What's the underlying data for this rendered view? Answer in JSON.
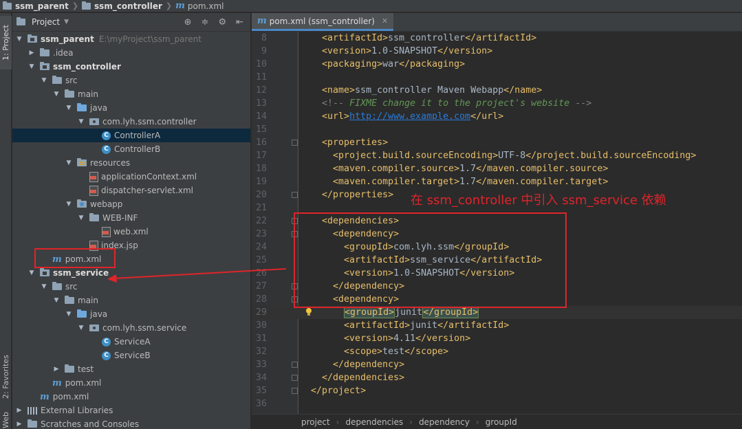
{
  "breadcrumb": [
    {
      "label": "ssm_parent",
      "icon": "folder-icon"
    },
    {
      "label": "ssm_controller",
      "icon": "folder-icon"
    },
    {
      "label": "pom.xml",
      "icon": "maven-icon"
    }
  ],
  "tool_strip": {
    "project_tab": "1: Project",
    "favorites_tab": "2: Favorites",
    "web_tab": "Web"
  },
  "project_panel": {
    "title": "Project",
    "tools": [
      "locate-icon",
      "collapse-icon",
      "gear-icon",
      "hide-icon"
    ],
    "tree": [
      {
        "label": "ssm_parent",
        "suffix": "E:\\myProject\\ssm_parent",
        "depth": 0,
        "arrow": "open",
        "icon": "module-folder",
        "bold": true
      },
      {
        "label": ".idea",
        "depth": 1,
        "arrow": "closed",
        "icon": "folder"
      },
      {
        "label": "ssm_controller",
        "depth": 1,
        "arrow": "open",
        "icon": "module-folder",
        "bold": true
      },
      {
        "label": "src",
        "depth": 2,
        "arrow": "open",
        "icon": "folder"
      },
      {
        "label": "main",
        "depth": 3,
        "arrow": "open",
        "icon": "folder"
      },
      {
        "label": "java",
        "depth": 4,
        "arrow": "open",
        "icon": "blue-folder"
      },
      {
        "label": "com.lyh.ssm.controller",
        "depth": 5,
        "arrow": "open",
        "icon": "package"
      },
      {
        "label": "ControllerA",
        "depth": 6,
        "arrow": "none",
        "icon": "class",
        "selected": true
      },
      {
        "label": "ControllerB",
        "depth": 6,
        "arrow": "none",
        "icon": "class"
      },
      {
        "label": "resources",
        "depth": 4,
        "arrow": "open",
        "icon": "resources-folder"
      },
      {
        "label": "applicationContext.xml",
        "depth": 5,
        "arrow": "none",
        "icon": "xml"
      },
      {
        "label": "dispatcher-servlet.xml",
        "depth": 5,
        "arrow": "none",
        "icon": "xml"
      },
      {
        "label": "webapp",
        "depth": 4,
        "arrow": "open",
        "icon": "web-folder"
      },
      {
        "label": "WEB-INF",
        "depth": 5,
        "arrow": "open",
        "icon": "folder"
      },
      {
        "label": "web.xml",
        "depth": 6,
        "arrow": "none",
        "icon": "xml"
      },
      {
        "label": "index.jsp",
        "depth": 5,
        "arrow": "none",
        "icon": "xml"
      },
      {
        "label": "pom.xml",
        "depth": 2,
        "arrow": "none",
        "icon": "maven"
      },
      {
        "label": "ssm_service",
        "depth": 1,
        "arrow": "open",
        "icon": "module-folder",
        "bold": true
      },
      {
        "label": "src",
        "depth": 2,
        "arrow": "open",
        "icon": "folder"
      },
      {
        "label": "main",
        "depth": 3,
        "arrow": "open",
        "icon": "folder"
      },
      {
        "label": "java",
        "depth": 4,
        "arrow": "open",
        "icon": "blue-folder"
      },
      {
        "label": "com.lyh.ssm.service",
        "depth": 5,
        "arrow": "open",
        "icon": "package"
      },
      {
        "label": "ServiceA",
        "depth": 6,
        "arrow": "none",
        "icon": "class"
      },
      {
        "label": "ServiceB",
        "depth": 6,
        "arrow": "none",
        "icon": "class"
      },
      {
        "label": "test",
        "depth": 3,
        "arrow": "closed",
        "icon": "folder"
      },
      {
        "label": "pom.xml",
        "depth": 2,
        "arrow": "none",
        "icon": "maven"
      },
      {
        "label": "pom.xml",
        "depth": 1,
        "arrow": "none",
        "icon": "maven"
      },
      {
        "label": "External Libraries",
        "depth": 0,
        "arrow": "closed",
        "icon": "library"
      },
      {
        "label": "Scratches and Consoles",
        "depth": 0,
        "arrow": "closed",
        "icon": "folder"
      }
    ]
  },
  "editor": {
    "tab_label": "pom.xml (ssm_controller)",
    "current_line": 29,
    "lines": [
      {
        "n": 8,
        "segs": [
          [
            "i",
            "    "
          ],
          [
            "t",
            "<artifactId>"
          ],
          [
            "x",
            "ssm_controller"
          ],
          [
            "t",
            "</artifactId>"
          ]
        ]
      },
      {
        "n": 9,
        "segs": [
          [
            "i",
            "    "
          ],
          [
            "t",
            "<version>"
          ],
          [
            "x",
            "1.0-SNAPSHOT"
          ],
          [
            "t",
            "</version>"
          ]
        ]
      },
      {
        "n": 10,
        "segs": [
          [
            "i",
            "    "
          ],
          [
            "t",
            "<packaging>"
          ],
          [
            "x",
            "war"
          ],
          [
            "t",
            "</packaging>"
          ]
        ]
      },
      {
        "n": 11,
        "segs": []
      },
      {
        "n": 12,
        "segs": [
          [
            "i",
            "    "
          ],
          [
            "t",
            "<name>"
          ],
          [
            "x",
            "ssm_controller Maven Webapp"
          ],
          [
            "t",
            "</name>"
          ]
        ]
      },
      {
        "n": 13,
        "segs": [
          [
            "i",
            "    "
          ],
          [
            "cmd",
            "<!-- "
          ],
          [
            "cm",
            "FIXME change it to the project's website"
          ],
          [
            "cmd",
            " -->"
          ]
        ]
      },
      {
        "n": 14,
        "segs": [
          [
            "i",
            "    "
          ],
          [
            "t",
            "<url>"
          ],
          [
            "lnk",
            "http://www.example.com"
          ],
          [
            "t",
            "</url>"
          ]
        ]
      },
      {
        "n": 15,
        "segs": []
      },
      {
        "n": 16,
        "segs": [
          [
            "i",
            "    "
          ],
          [
            "t",
            "<properties>"
          ]
        ],
        "fold": true
      },
      {
        "n": 17,
        "segs": [
          [
            "i",
            "      "
          ],
          [
            "t",
            "<project.build.sourceEncoding>"
          ],
          [
            "x",
            "UTF-8"
          ],
          [
            "t",
            "</project.build.sourceEncoding>"
          ]
        ]
      },
      {
        "n": 18,
        "segs": [
          [
            "i",
            "      "
          ],
          [
            "t",
            "<maven.compiler.source>"
          ],
          [
            "x",
            "1.7"
          ],
          [
            "t",
            "</maven.compiler.source>"
          ]
        ]
      },
      {
        "n": 19,
        "segs": [
          [
            "i",
            "      "
          ],
          [
            "t",
            "<maven.compiler.target>"
          ],
          [
            "x",
            "1.7"
          ],
          [
            "t",
            "</maven.compiler.target>"
          ]
        ]
      },
      {
        "n": 20,
        "segs": [
          [
            "i",
            "    "
          ],
          [
            "t",
            "</properties>"
          ]
        ],
        "fold": true
      },
      {
        "n": 21,
        "segs": []
      },
      {
        "n": 22,
        "segs": [
          [
            "i",
            "    "
          ],
          [
            "t",
            "<dependencies>"
          ]
        ],
        "fold": true
      },
      {
        "n": 23,
        "segs": [
          [
            "i",
            "      "
          ],
          [
            "t",
            "<dependency>"
          ]
        ],
        "fold": true
      },
      {
        "n": 24,
        "segs": [
          [
            "i",
            "        "
          ],
          [
            "t",
            "<groupId>"
          ],
          [
            "x",
            "com.lyh.ssm"
          ],
          [
            "t",
            "</groupId>"
          ]
        ]
      },
      {
        "n": 25,
        "segs": [
          [
            "i",
            "        "
          ],
          [
            "t",
            "<artifactId>"
          ],
          [
            "x",
            "ssm_service"
          ],
          [
            "t",
            "</artifactId>"
          ]
        ]
      },
      {
        "n": 26,
        "segs": [
          [
            "i",
            "        "
          ],
          [
            "t",
            "<version>"
          ],
          [
            "x",
            "1.0-SNAPSHOT"
          ],
          [
            "t",
            "</version>"
          ]
        ]
      },
      {
        "n": 27,
        "segs": [
          [
            "i",
            "      "
          ],
          [
            "t",
            "</dependency>"
          ]
        ],
        "fold": true
      },
      {
        "n": 28,
        "segs": [
          [
            "i",
            "      "
          ],
          [
            "t",
            "<dependency>"
          ]
        ],
        "fold": true
      },
      {
        "n": 29,
        "segs": [
          [
            "i",
            "        "
          ],
          [
            "th",
            "<groupId>"
          ],
          [
            "x",
            "junit"
          ],
          [
            "th",
            "</groupId>"
          ]
        ],
        "bulb": true
      },
      {
        "n": 30,
        "segs": [
          [
            "i",
            "        "
          ],
          [
            "t",
            "<artifactId>"
          ],
          [
            "x",
            "junit"
          ],
          [
            "t",
            "</artifactId>"
          ]
        ]
      },
      {
        "n": 31,
        "segs": [
          [
            "i",
            "        "
          ],
          [
            "t",
            "<version>"
          ],
          [
            "x",
            "4.11"
          ],
          [
            "t",
            "</version>"
          ]
        ]
      },
      {
        "n": 32,
        "segs": [
          [
            "i",
            "        "
          ],
          [
            "t",
            "<scope>"
          ],
          [
            "x",
            "test"
          ],
          [
            "t",
            "</scope>"
          ]
        ]
      },
      {
        "n": 33,
        "segs": [
          [
            "i",
            "      "
          ],
          [
            "t",
            "</dependency>"
          ]
        ],
        "fold": true
      },
      {
        "n": 34,
        "segs": [
          [
            "i",
            "    "
          ],
          [
            "t",
            "</dependencies>"
          ]
        ],
        "fold": true
      },
      {
        "n": 35,
        "segs": [
          [
            "i",
            "  "
          ],
          [
            "t",
            "</project>"
          ]
        ],
        "fold": true
      },
      {
        "n": 36,
        "segs": []
      }
    ],
    "crumbs": [
      "project",
      "dependencies",
      "dependency",
      "groupId"
    ]
  },
  "annotation": {
    "text": "在 ssm_controller 中引入 ssm_service 依赖",
    "color": "#e0242a"
  },
  "colors": {
    "tag": "#e8bf6a",
    "text": "#a9b7c6",
    "comment": "#629755",
    "link": "#287bde",
    "selection": "#0d293e",
    "accent": "#4a88c7"
  }
}
